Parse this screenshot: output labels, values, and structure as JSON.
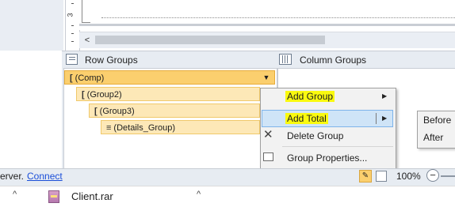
{
  "ruler": {
    "marker": "3"
  },
  "grouping_pane": {
    "row_groups_header": "Row Groups",
    "column_groups_header": "Column Groups",
    "row_groups": [
      {
        "bracket": "[",
        "label": "(Comp)"
      },
      {
        "bracket": "[",
        "label": "(Group2)"
      },
      {
        "bracket": "[",
        "label": "(Group3)"
      },
      {
        "bracket": "≡",
        "label": "(Details_Group)"
      }
    ]
  },
  "context_menu": {
    "items": [
      {
        "label": "Add Group",
        "highlighted": true,
        "has_submenu": true
      },
      {
        "label": "Add Total",
        "highlighted": true,
        "has_submenu": true,
        "active": true
      },
      {
        "label": "Delete Group",
        "icon": "delete-icon"
      },
      {
        "label": "Group Properties...",
        "icon": "properties-icon"
      }
    ],
    "highlight_color": "#fafa0f",
    "hover_color": "#cfe4f7"
  },
  "submenu": {
    "items": [
      {
        "label": "Before"
      },
      {
        "label": "After"
      }
    ]
  },
  "status_bar": {
    "text": "erver.",
    "link": "Connect",
    "zoom": "100%"
  },
  "download_bar": {
    "file_name": "Client.rar",
    "chevron": "^"
  },
  "colors": {
    "group_fill": "#fde8b7",
    "group_selected": "#fbcf6e",
    "pane_background": "#e7ecf2",
    "link": "#1a4ed8"
  }
}
